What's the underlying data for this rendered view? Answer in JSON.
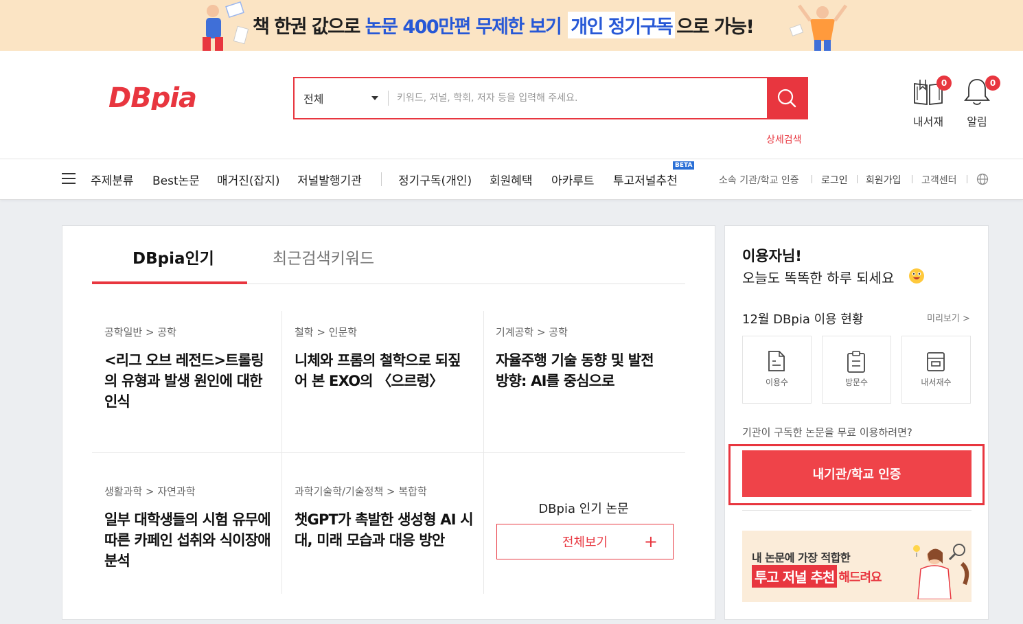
{
  "banner": {
    "part1": "책 한권 값으로",
    "part2": "논문 400만편 무제한 보기",
    "part3": "개인 정기구독",
    "part4": "으로 가능!"
  },
  "header": {
    "logo_text": "DBpia",
    "search_scope": "전체",
    "search_placeholder": "키워드, 저널, 학회, 저자 등을 입력해 주세요.",
    "advanced_search": "상세검색",
    "library_label": "내서재",
    "library_count": "0",
    "alarm_label": "알림",
    "alarm_count": "0"
  },
  "nav": {
    "items": [
      "주제분류",
      "Best논문",
      "매거진(잡지)",
      "저널발행기관",
      "정기구독(개인)",
      "회원혜택",
      "아카루트",
      "투고저널추천"
    ],
    "beta": "BETA",
    "utility": [
      "소속 기관/학교 인증",
      "로그인",
      "회원가입",
      "고객센터"
    ]
  },
  "tabs": {
    "active": "DBpia인기",
    "inactive": "최근검색키워드"
  },
  "papers": [
    {
      "category": "공학일반 > 공학",
      "title": "<리그 오브 레전드>트롤링의 유형과 발생 원인에 대한 인식"
    },
    {
      "category": "철학 > 인문학",
      "title": "니체와 프롬의 철학으로 되짚어 본 EXO의 〈으르렁〉"
    },
    {
      "category": "기계공학 > 공학",
      "title": "자율주행 기술 동향 및 발전 방향: AI를 중심으로"
    },
    {
      "category": "생활과학 > 자연과학",
      "title": "일부 대학생들의 시험 유무에 따른 카페인 섭취와 식이장애 분석"
    },
    {
      "category": "과학기술학/기술정책 > 복합학",
      "title": "챗GPT가 촉발한 생성형 AI 시대, 미래 모습과 대응 방안"
    }
  ],
  "popular": {
    "title": "DBpia 인기 논문",
    "view_all": "전체보기",
    "plus": "+"
  },
  "side": {
    "greeting_name": "이용자님!",
    "greeting_msg": "오늘도 똑똑한 하루 되세요",
    "stats_title": "12월 DBpia 이용 현황",
    "preview": "미리보기 >",
    "stats": [
      "이용수",
      "방문수",
      "내서재수"
    ],
    "institution_question": "기관이 구독한 논문을 무료 이용하려면?",
    "institution_button": "내기관/학교 인증",
    "promo_line1": "내 논문에 가장 적합한",
    "promo_highlight": "투고 저널 추천",
    "promo_tail": "해드려요"
  },
  "colors": {
    "brand_red": "#e8363f",
    "banner_bg": "#fbe4c4",
    "banner_blue": "#2758d6",
    "beta_blue": "#2a6fd6"
  }
}
